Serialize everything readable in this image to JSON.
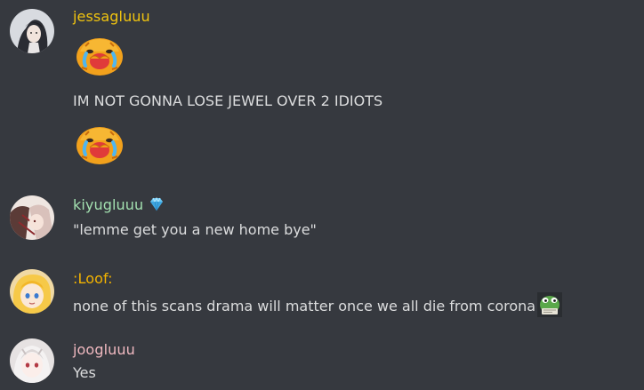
{
  "colors": {
    "background": "#36393f",
    "text": "#dcddde",
    "jessa_name": "#f1c40f",
    "kiyu_name": "#a3e0b0",
    "loof_name": "#f4b400",
    "joog_name": "#f0b9c0"
  },
  "messages": [
    {
      "username": "jessagluuu",
      "lines": [
        {
          "type": "emoji",
          "icon": "crying-hug-emoji"
        },
        {
          "type": "text",
          "text": "IM NOT GONNA LOSE JEWEL OVER 2 IDIOTS"
        },
        {
          "type": "emoji",
          "icon": "crying-hug-emoji"
        }
      ]
    },
    {
      "username": "kiyugluuu",
      "badge_icon": "diamond-icon",
      "text": "\"lemme get you a new home bye\""
    },
    {
      "username": ":Loof:",
      "text": "none of this scans drama will matter once we all die from corona",
      "inline_emoji": "frog-emoji"
    },
    {
      "username": "joogluuu",
      "text": "Yes"
    }
  ]
}
